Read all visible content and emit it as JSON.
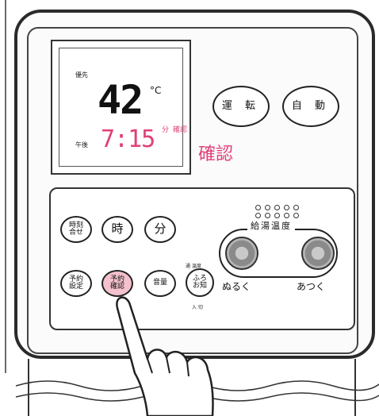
{
  "display": {
    "label_top": "優先",
    "temperature": "42",
    "unit": "°C",
    "label_time": "午後",
    "time": "7:15",
    "time_suffix": "分",
    "confirm_small": "確認",
    "confirm_note": "確認"
  },
  "buttons": {
    "run": "運 転",
    "auto": "自 動",
    "time_set": "時刻\n合せ",
    "hour": "時",
    "minute": "分",
    "afternoon_set": "予約\n設定",
    "reservation_confirm": "予約\n確認",
    "sound": "音量",
    "voice_bath": "ふろ\nお知"
  },
  "hot_water": {
    "title": "給湯温度",
    "lower": "ぬるく",
    "higher": "あつく"
  },
  "tiny_labels": {
    "small_top": "通 温度",
    "small_bottom": "入 切"
  },
  "colors": {
    "accent_pink": "#e0407a",
    "pressed_button": "#f4c1cd"
  }
}
